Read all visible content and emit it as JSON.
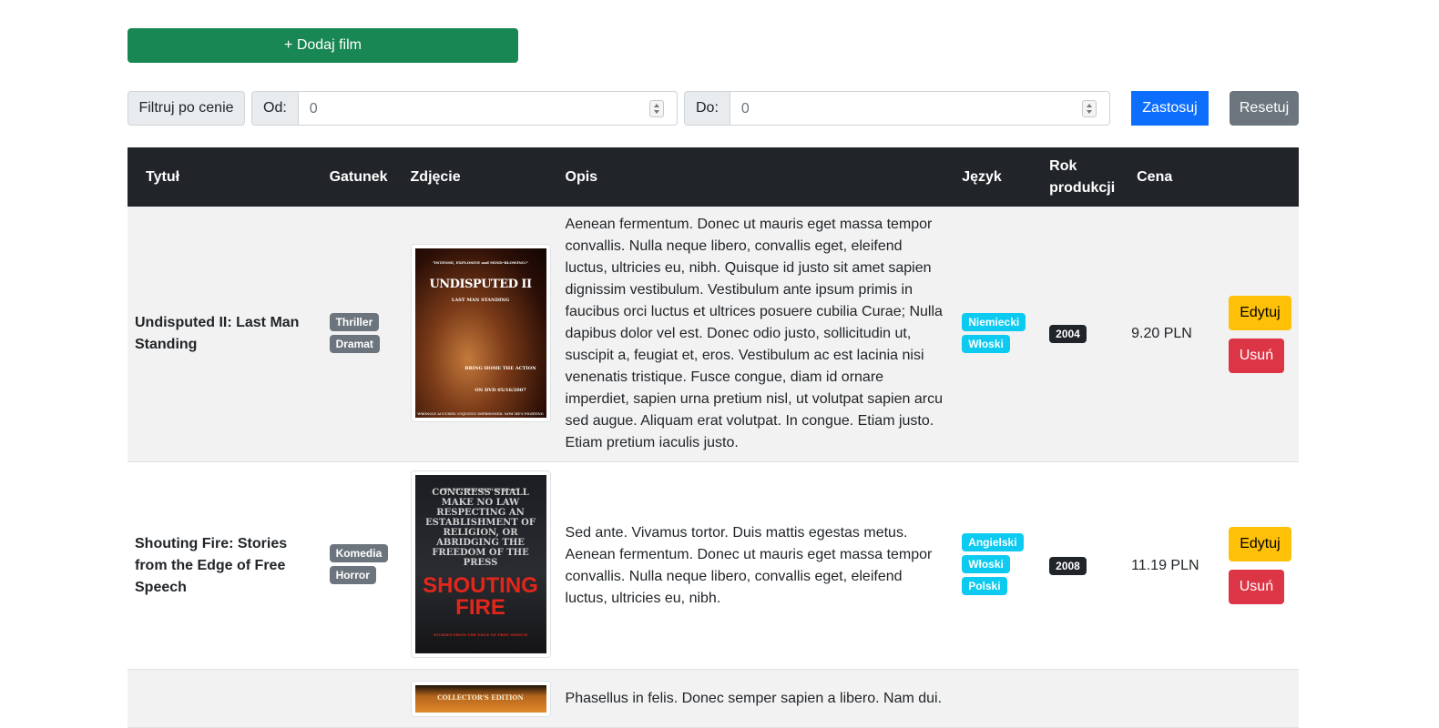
{
  "toolbar": {
    "add_label": "+ Dodaj film"
  },
  "filter": {
    "label": "Filtruj po cenie",
    "from_label": "Od:",
    "from_value": "0",
    "to_label": "Do:",
    "to_value": "0",
    "apply_label": "Zastosuj",
    "reset_label": "Resetuj"
  },
  "table": {
    "headers": {
      "title": "Tytuł",
      "genre": "Gatunek",
      "image": "Zdjęcie",
      "description": "Opis",
      "language": "Język",
      "year": "Rok produkcji",
      "price": "Cena"
    },
    "rows": [
      {
        "title": "Undisputed II: Last Man Standing",
        "genres": [
          "Thriller",
          "Dramat"
        ],
        "poster_title": "UNDISPUTED II",
        "poster_sub": "LAST MAN STANDING",
        "poster_tag": "\"INTENSE, EXPLOSIVE and MIND-BLOWING!\"",
        "poster_date": "BRING HOME THE ACTION ON DVD 05/16/2007",
        "poster_foot": "WRONGLY ACCUSED. UNJUSTLY IMPRISONED. NOW HE'S FIGHTING BACK.",
        "description": "Aenean fermentum. Donec ut mauris eget massa tempor convallis. Nulla neque libero, convallis eget, eleifend luctus, ultricies eu, nibh. Quisque id justo sit amet sapien dignissim vestibulum. Vestibulum ante ipsum primis in faucibus orci luctus et ultrices posuere cubilia Curae; Nulla dapibus dolor vel est. Donec odio justo, sollicitudin ut, suscipit a, feugiat et, eros. Vestibulum ac est lacinia nisi venenatis tristique. Fusce congue, diam id ornare imperdiet, sapien urna pretium nisl, ut volutpat sapien arcu sed augue. Aliquam erat volutpat. In congue. Etiam justo. Etiam pretium iaculis justo.",
        "languages": [
          "Niemiecki",
          "Włoski"
        ],
        "year": "2004",
        "price": "9.20 PLN",
        "edit_label": "Edytuj",
        "delete_label": "Usuń"
      },
      {
        "title": "Shouting Fire: Stories from the Edge of Free Speech",
        "genres": [
          "Komedia",
          "Horror"
        ],
        "poster_top": "HBO DOCUMENTARY FILMS presents",
        "poster_quote": "CONGRESS SHALL MAKE NO LAW RESPECTING AN ESTABLISHMENT OF RELIGION, OR ABRIDGING THE FREEDOM OF THE PRESS",
        "poster_title": "SHOUTING FIRE",
        "poster_sub": "STORIES FROM THE EDGE OF FREE SPEECH",
        "description": "Sed ante. Vivamus tortor. Duis mattis egestas metus. Aenean fermentum. Donec ut mauris eget massa tempor convallis. Nulla neque libero, convallis eget, eleifend luctus, ultricies eu, nibh.",
        "languages": [
          "Angielski",
          "Włoski",
          "Polski"
        ],
        "year": "2008",
        "price": "11.19 PLN",
        "edit_label": "Edytuj",
        "delete_label": "Usuń"
      },
      {
        "poster_top": "COLLECTOR'S EDITION",
        "description": "Phasellus in felis. Donec semper sapien a libero. Nam dui."
      }
    ]
  }
}
